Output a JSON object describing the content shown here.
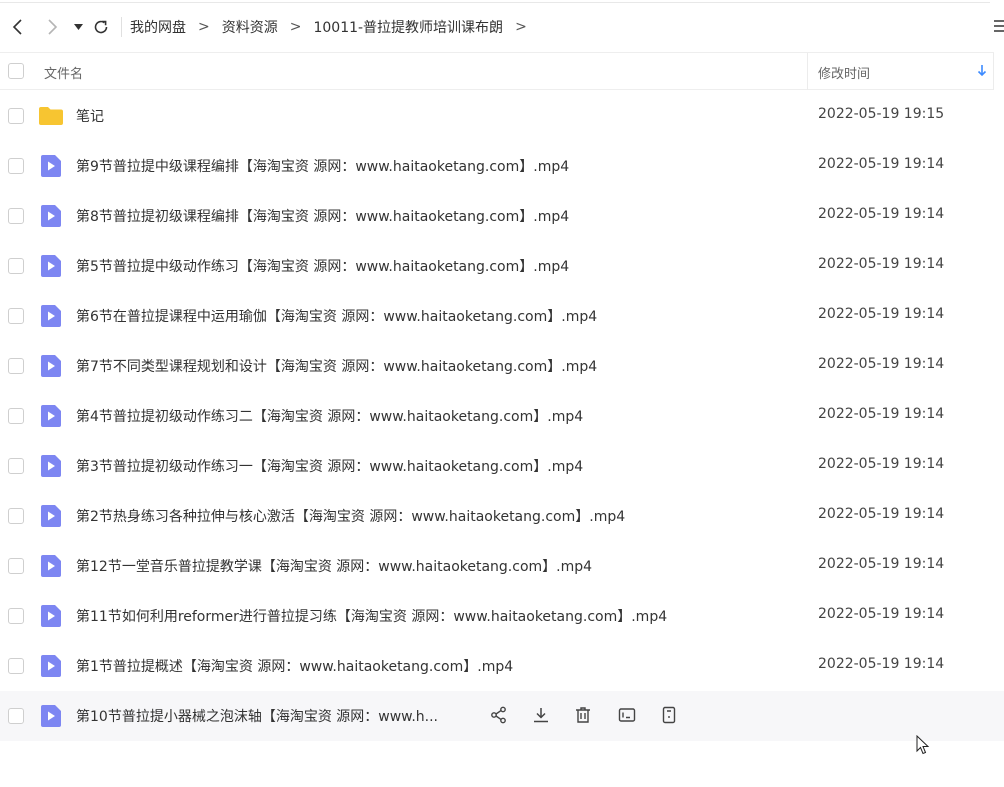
{
  "breadcrumb": [
    "我的网盘",
    "资料资源",
    "10011-普拉提教师培训课布朗"
  ],
  "breadcrumb_separator": ">",
  "header": {
    "name_label": "文件名",
    "time_label": "修改时间"
  },
  "files": [
    {
      "type": "folder",
      "name": "笔记",
      "time": "2022-05-19 19:15"
    },
    {
      "type": "video",
      "name": "第9节普拉提中级课程编排【海淘宝资 源网：www.haitaoketang.com】.mp4",
      "time": "2022-05-19 19:14"
    },
    {
      "type": "video",
      "name": "第8节普拉提初级课程编排【海淘宝资 源网：www.haitaoketang.com】.mp4",
      "time": "2022-05-19 19:14"
    },
    {
      "type": "video",
      "name": "第5节普拉提中级动作练习【海淘宝资 源网：www.haitaoketang.com】.mp4",
      "time": "2022-05-19 19:14"
    },
    {
      "type": "video",
      "name": "第6节在普拉提课程中运用瑜伽【海淘宝资 源网：www.haitaoketang.com】.mp4",
      "time": "2022-05-19 19:14"
    },
    {
      "type": "video",
      "name": "第7节不同类型课程规划和设计【海淘宝资 源网：www.haitaoketang.com】.mp4",
      "time": "2022-05-19 19:14"
    },
    {
      "type": "video",
      "name": "第4节普拉提初级动作练习二【海淘宝资 源网：www.haitaoketang.com】.mp4",
      "time": "2022-05-19 19:14"
    },
    {
      "type": "video",
      "name": "第3节普拉提初级动作练习一【海淘宝资 源网：www.haitaoketang.com】.mp4",
      "time": "2022-05-19 19:14"
    },
    {
      "type": "video",
      "name": "第2节热身练习各种拉伸与核心激活【海淘宝资 源网：www.haitaoketang.com】.mp4",
      "time": "2022-05-19 19:14"
    },
    {
      "type": "video",
      "name": "第12节一堂音乐普拉提教学课【海淘宝资 源网：www.haitaoketang.com】.mp4",
      "time": "2022-05-19 19:14"
    },
    {
      "type": "video",
      "name": "第11节如何利用reformer进行普拉提习练【海淘宝资 源网：www.haitaoketang.com】.mp4",
      "time": "2022-05-19 19:14"
    },
    {
      "type": "video",
      "name": "第1节普拉提概述【海淘宝资 源网：www.haitaoketang.com】.mp4",
      "time": "2022-05-19 19:14"
    },
    {
      "type": "video",
      "name": "第10节普拉提小器械之泡沫轴【海淘宝资 源网：www.h...",
      "time": "",
      "hover": true
    }
  ],
  "row_actions": [
    "share-icon",
    "download-icon",
    "delete-icon",
    "rename-icon",
    "more-icon"
  ],
  "colors": {
    "folder": "#f7c531",
    "video": "#7d86f2",
    "sort_arrow": "#3d8bff"
  }
}
